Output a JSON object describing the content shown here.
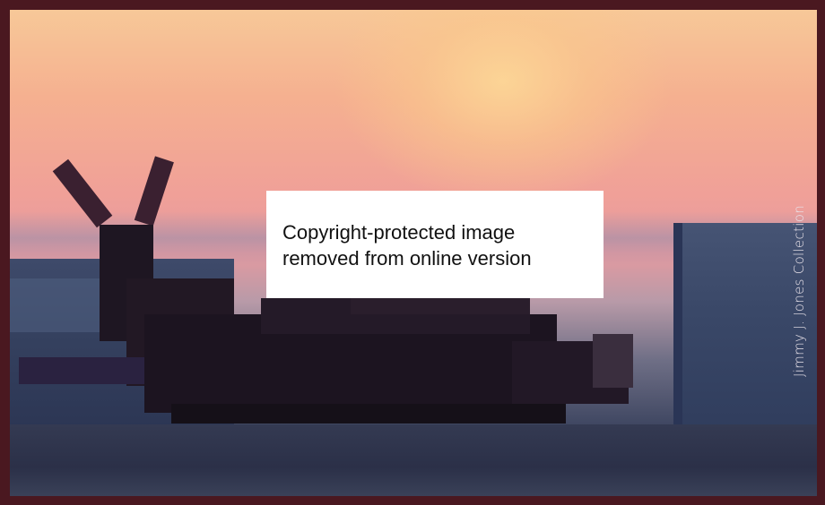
{
  "notice": {
    "line1": "Copyright-protected image",
    "line2": "removed from online version"
  },
  "credit": "Jimmy J. Jones Collection",
  "colors": {
    "frame": "#4a1820",
    "sky_top": "#f7c898",
    "sky_mid": "#f0a098",
    "ground": "#2b3048",
    "silhouette": "#1c1420"
  }
}
